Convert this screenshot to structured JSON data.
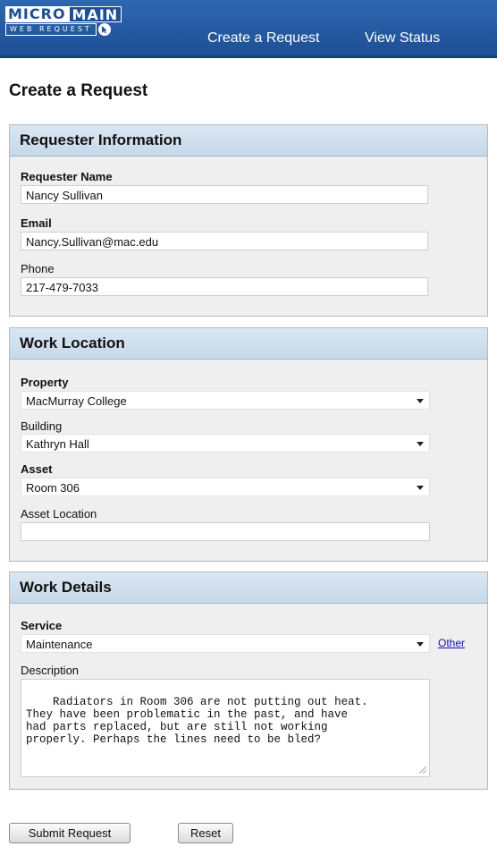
{
  "header": {
    "logo": {
      "micro": "MICRO",
      "main": "MAIN",
      "sub": "WEB REQUEST"
    },
    "nav": {
      "create": "Create a Request",
      "status": "View Status"
    }
  },
  "page_title": "Create a Request",
  "requester": {
    "heading": "Requester Information",
    "name_label": "Requester Name",
    "name_value": "Nancy Sullivan",
    "email_label": "Email",
    "email_value": "Nancy.Sullivan@mac.edu",
    "phone_label": "Phone",
    "phone_value": "217-479-7033"
  },
  "location": {
    "heading": "Work Location",
    "property_label": "Property",
    "property_value": "MacMurray College",
    "building_label": "Building",
    "building_value": "Kathryn Hall",
    "asset_label": "Asset",
    "asset_value": "Room 306",
    "asset_location_label": "Asset Location",
    "asset_location_value": ""
  },
  "details": {
    "heading": "Work Details",
    "service_label": "Service",
    "service_value": "Maintenance",
    "other_link": "Other",
    "description_label": "Description",
    "description_value": "Radiators in Room 306 are not putting out heat.\nThey have been problematic in the past, and have\nhad parts replaced, but are still not working\nproperly. Perhaps the lines need to be bled?"
  },
  "buttons": {
    "submit": "Submit Request",
    "reset": "Reset"
  },
  "colors": {
    "header_bg": "#1d4f95",
    "section_head_bg": "#c6d8e9",
    "panel_bg": "#efefef"
  }
}
